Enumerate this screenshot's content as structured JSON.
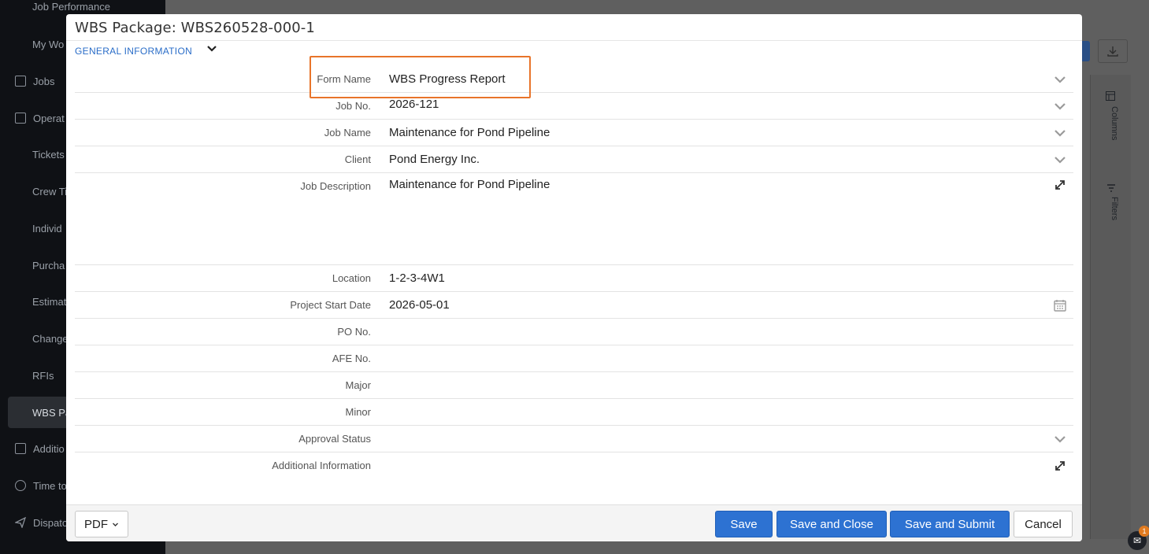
{
  "background": {
    "nav_items": [
      {
        "label": "Job Performance",
        "icon": "none"
      },
      {
        "label": "My Wo",
        "icon": "none"
      },
      {
        "label": "Jobs",
        "icon": "folder-icon"
      },
      {
        "label": "Operat",
        "icon": "clipboard-icon"
      },
      {
        "label": "Tickets",
        "icon": "none"
      },
      {
        "label": "Crew Ti",
        "icon": "none"
      },
      {
        "label": "Individ",
        "icon": "none"
      },
      {
        "label": "Purcha",
        "icon": "none"
      },
      {
        "label": "Estimat",
        "icon": "none"
      },
      {
        "label": "Change",
        "icon": "none"
      },
      {
        "label": "RFIs",
        "icon": "none"
      },
      {
        "label": "WBS Pa",
        "icon": "none",
        "active": true
      },
      {
        "label": "Additio",
        "icon": "copy-icon"
      },
      {
        "label": "Time to",
        "icon": "clock-icon"
      },
      {
        "label": "Dispato",
        "icon": "send-icon"
      }
    ],
    "side_panel": {
      "columns_label": "Columns",
      "filters_label": "Filters"
    },
    "chat_badge_count": "1"
  },
  "modal": {
    "title": "WBS Package: WBS260528-000-1",
    "section_title": "GENERAL INFORMATION",
    "fields": [
      {
        "label": "Form Name",
        "value": "WBS Progress Report",
        "control": "chevron"
      },
      {
        "label": "Job No.",
        "value": "2026-121",
        "control": "chevron"
      },
      {
        "label": "Job Name",
        "value": "Maintenance for Pond Pipeline",
        "control": "chevron"
      },
      {
        "label": "Client",
        "value": "Pond Energy Inc.",
        "control": "chevron"
      },
      {
        "label": "Job Description",
        "value": "Maintenance for Pond Pipeline",
        "control": "expand"
      },
      {
        "label": "Location",
        "value": "1-2-3-4W1",
        "control": "none"
      },
      {
        "label": "Project Start Date",
        "value": "2026-05-01",
        "control": "calendar"
      },
      {
        "label": "PO No.",
        "value": "",
        "control": "none"
      },
      {
        "label": "AFE No.",
        "value": "",
        "control": "none"
      },
      {
        "label": "Major",
        "value": "",
        "control": "none"
      },
      {
        "label": "Minor",
        "value": "",
        "control": "none"
      },
      {
        "label": "Approval Status",
        "value": "",
        "control": "chevron"
      },
      {
        "label": "Additional Information",
        "value": "",
        "control": "expand"
      }
    ],
    "footer": {
      "pdf_label": "PDF",
      "save_label": "Save",
      "save_close_label": "Save and Close",
      "save_submit_label": "Save and Submit",
      "cancel_label": "Cancel"
    }
  },
  "colors": {
    "accent_blue": "#2d72d2",
    "section_link": "#2a6dc8",
    "highlight": "#e8742a"
  }
}
